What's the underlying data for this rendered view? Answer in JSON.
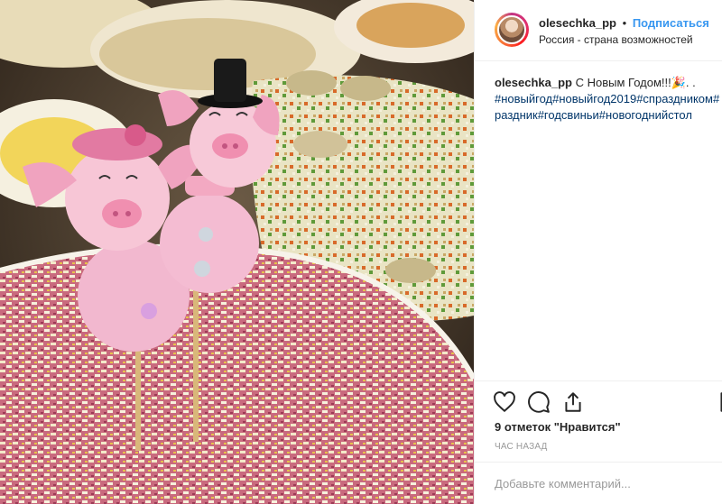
{
  "post": {
    "username": "olesechka_pp",
    "separator": "•",
    "follow_label": "Подписаться",
    "location": "Россия - страна возможностей"
  },
  "caption": {
    "username": "olesechka_pp",
    "text": " С Новым Годом!!!🎉. .",
    "hashtags_line1": "#новыйгод#новыйгод2019#спраздником#",
    "hashtags_line2": "раздник#годсвиньи#новогоднийстол"
  },
  "actions": {
    "like_icon": "heart-icon",
    "comment_icon": "comment-icon",
    "share_icon": "share-icon",
    "bookmark_icon": "bookmark-icon"
  },
  "likes_text": "9 отметок \"Нравится\"",
  "time_text": "ЧАС НАЗАД",
  "comment": {
    "placeholder": "Добавьте комментарий..."
  },
  "colors": {
    "follow": "#3897f0",
    "hashtag": "#003569",
    "muted": "#999999"
  }
}
